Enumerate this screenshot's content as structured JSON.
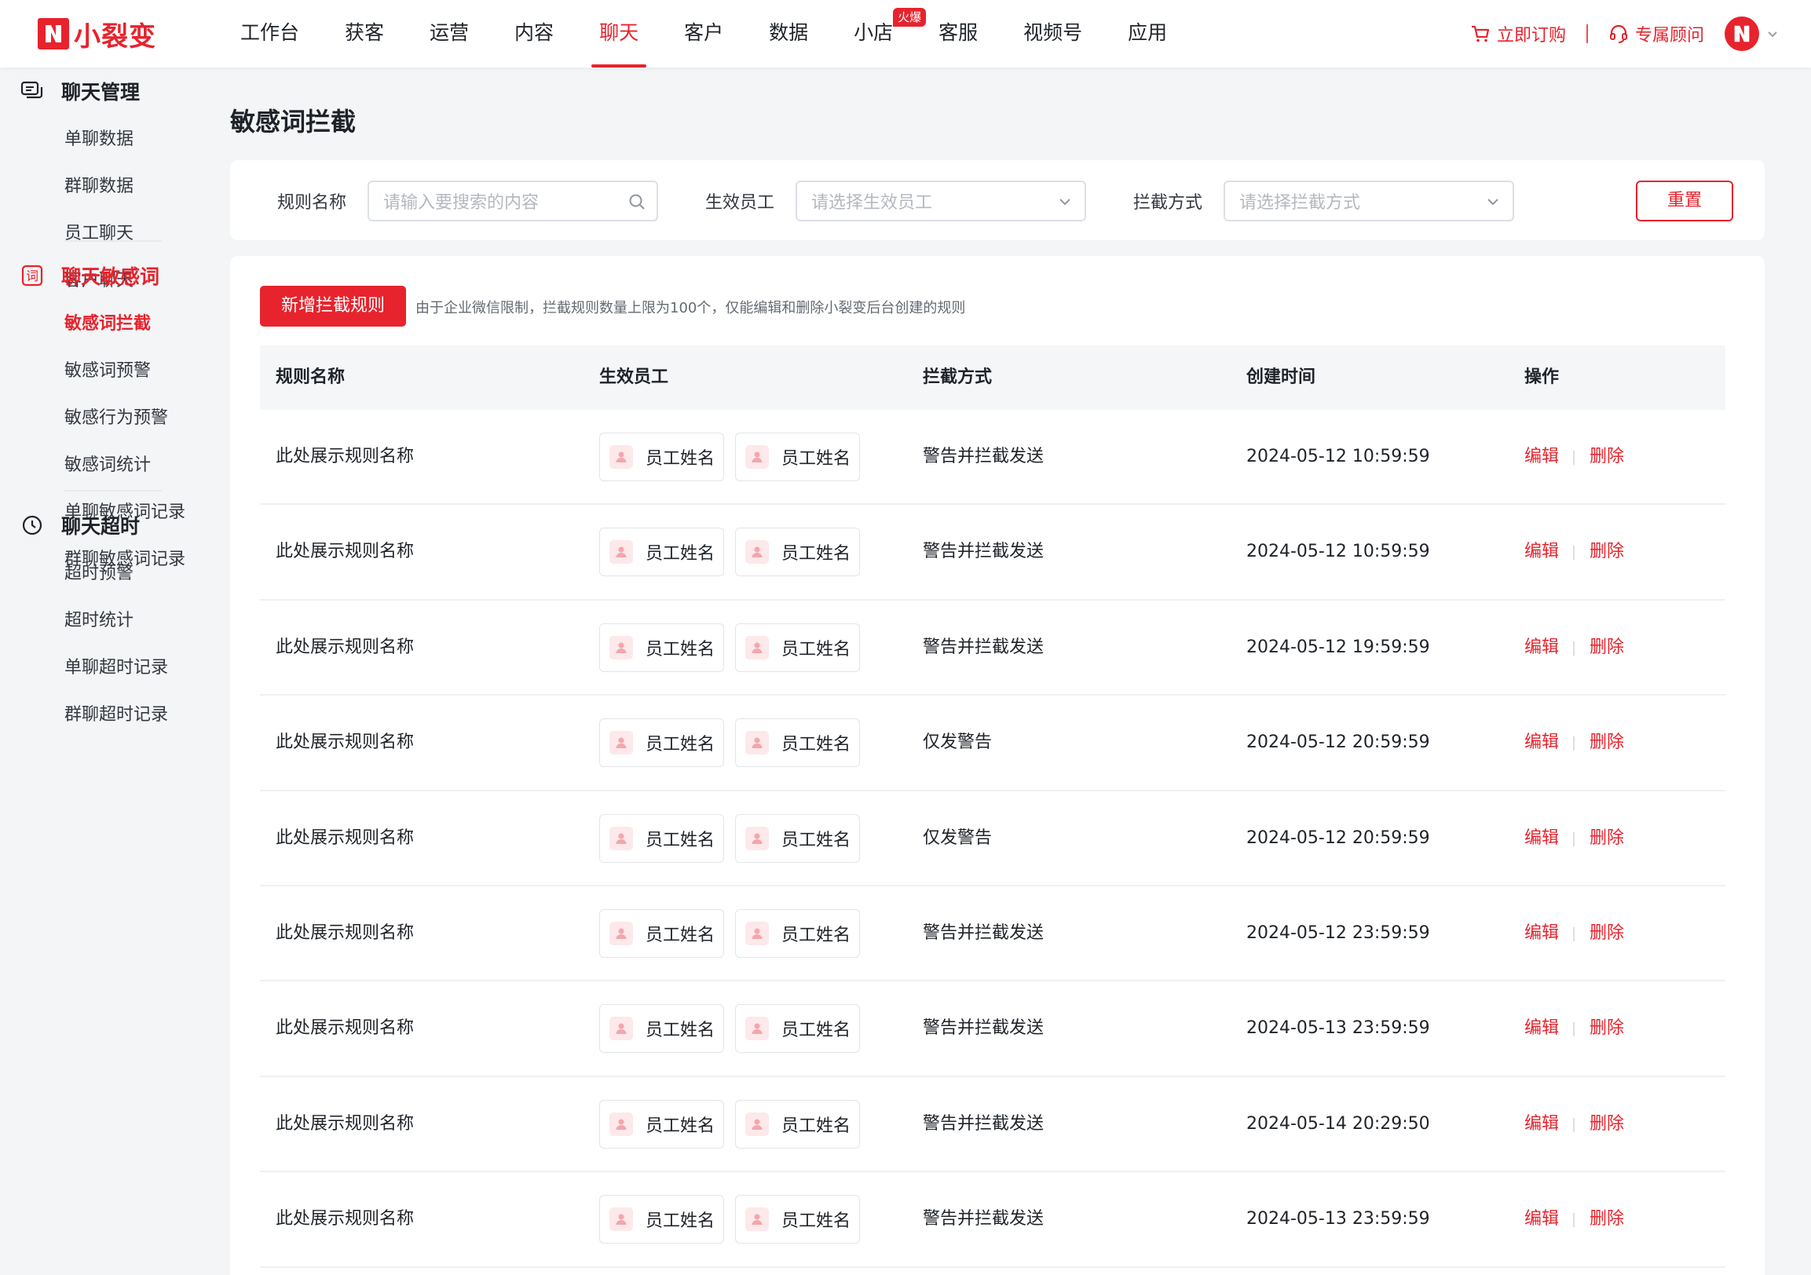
{
  "brand": {
    "name": "小裂变"
  },
  "nav": {
    "items": [
      "工作台",
      "获客",
      "运营",
      "内容",
      "聊天",
      "客户",
      "数据",
      "小店",
      "客服",
      "视频号",
      "应用"
    ],
    "active": "聊天",
    "badge": "火爆"
  },
  "topbar": {
    "order_label": "立即订购",
    "advisor_label": "专属顾问"
  },
  "sidebar": {
    "groups": [
      {
        "title": "聊天管理",
        "items": [
          "单聊数据",
          "群聊数据",
          "员工聊天",
          "客户聊天"
        ]
      },
      {
        "title": "聊天敏感词",
        "items": [
          "敏感词拦截",
          "敏感词预警",
          "敏感行为预警",
          "敏感词统计",
          "单聊敏感词记录",
          "群聊敏感词记录"
        ]
      },
      {
        "title": "聊天超时",
        "items": [
          "超时预警",
          "超时统计",
          "单聊超时记录",
          "群聊超时记录"
        ]
      }
    ],
    "active_item": "敏感词拦截",
    "group_icon_char": "词"
  },
  "page": {
    "title": "敏感词拦截"
  },
  "filters": {
    "rule_name_label": "规则名称",
    "rule_name_placeholder": "请输入要搜索的内容",
    "staff_label": "生效员工",
    "staff_placeholder": "请选择生效员工",
    "mode_label": "拦截方式",
    "mode_placeholder": "请选择拦截方式",
    "reset_label": "重置"
  },
  "toolbar": {
    "add_label": "新增拦截规则",
    "tip": "由于企业微信限制，拦截规则数量上限为100个，仅能编辑和删除小裂变后台创建的规则"
  },
  "table": {
    "headers": [
      "规则名称",
      "生效员工",
      "拦截方式",
      "创建时间",
      "操作"
    ],
    "edit_label": "编辑",
    "delete_label": "删除",
    "rows": [
      {
        "name": "此处展示规则名称",
        "staff": [
          "员工姓名",
          "员工姓名"
        ],
        "mode": "警告并拦截发送",
        "time": "2024-05-12 10:59:59"
      },
      {
        "name": "此处展示规则名称",
        "staff": [
          "员工姓名",
          "员工姓名"
        ],
        "mode": "警告并拦截发送",
        "time": "2024-05-12 10:59:59"
      },
      {
        "name": "此处展示规则名称",
        "staff": [
          "员工姓名",
          "员工姓名"
        ],
        "mode": "警告并拦截发送",
        "time": "2024-05-12 19:59:59"
      },
      {
        "name": "此处展示规则名称",
        "staff": [
          "员工姓名",
          "员工姓名"
        ],
        "mode": "仅发警告",
        "time": "2024-05-12 20:59:59"
      },
      {
        "name": "此处展示规则名称",
        "staff": [
          "员工姓名",
          "员工姓名"
        ],
        "mode": "仅发警告",
        "time": "2024-05-12 20:59:59"
      },
      {
        "name": "此处展示规则名称",
        "staff": [
          "员工姓名",
          "员工姓名"
        ],
        "mode": "警告并拦截发送",
        "time": "2024-05-12 23:59:59"
      },
      {
        "name": "此处展示规则名称",
        "staff": [
          "员工姓名",
          "员工姓名"
        ],
        "mode": "警告并拦截发送",
        "time": "2024-05-13 23:59:59"
      },
      {
        "name": "此处展示规则名称",
        "staff": [
          "员工姓名",
          "员工姓名"
        ],
        "mode": "警告并拦截发送",
        "time": "2024-05-14 20:29:50"
      },
      {
        "name": "此处展示规则名称",
        "staff": [
          "员工姓名",
          "员工姓名"
        ],
        "mode": "警告并拦截发送",
        "time": "2024-05-13 23:59:59"
      }
    ]
  },
  "colors": {
    "accent": "#e7232d",
    "background": "#f4f5f7",
    "header_bg": "#f5f6f8"
  }
}
